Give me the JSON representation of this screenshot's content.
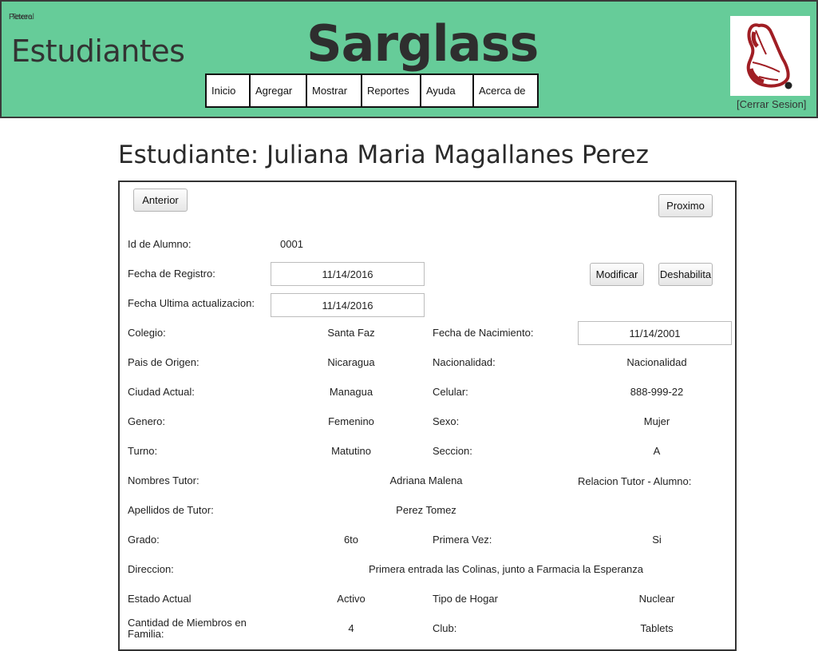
{
  "header": {
    "overlap_text_a": "Petero",
    "overlap_text_b": "Texeal",
    "app_name": "Estudiantes",
    "brand": "Sarglass",
    "logout": "[Cerrar Sesion]"
  },
  "nav": [
    "Inicio",
    "Agregar",
    "Mostrar",
    "Reportes",
    "Ayuda",
    "Acerca de"
  ],
  "page": {
    "title": "Estudiante: Juliana Maria Magallanes Perez"
  },
  "buttons": {
    "prev": "Anterior",
    "next": "Proximo",
    "edit": "Modificar",
    "disable": "Deshabilita"
  },
  "fields": {
    "id_label": "Id de Alumno:",
    "id_value": "0001",
    "registro_label": "Fecha de Registro:",
    "registro_value": "11/14/2016",
    "actualizacion_label": "Fecha Ultima actualizacion:",
    "actualizacion_value": "11/14/2016",
    "colegio_label": "Colegio:",
    "colegio_value": "Santa Faz",
    "nacimiento_label": "Fecha de Nacimiento:",
    "nacimiento_value": "11/14/2001",
    "pais_label": "Pais de Origen:",
    "pais_value": "Nicaragua",
    "nacionalidad_label": "Nacionalidad:",
    "nacionalidad_value": "Nacionalidad",
    "ciudad_label": "Ciudad Actual:",
    "ciudad_value": "Managua",
    "celular_label": "Celular:",
    "celular_value": "888-999-22",
    "genero_label": "Genero:",
    "genero_value": "Femenino",
    "sexo_label": "Sexo:",
    "sexo_value": "Mujer",
    "turno_label": "Turno:",
    "turno_value": "Matutino",
    "seccion_label": "Seccion:",
    "seccion_value": "A",
    "tutor_label": "Nombres Tutor:",
    "tutor_value": "Adriana Malena",
    "relacion_label": "Relacion Tutor - Alumno:",
    "apellidos_label": "Apellidos de Tutor:",
    "apellidos_value": "Perez Tomez",
    "grado_label": "Grado:",
    "grado_value": "6to",
    "primera_label": "Primera Vez:",
    "primera_value": "Si",
    "direccion_label": "Direccion:",
    "direccion_value": "Primera entrada las Colinas, junto a Farmacia la Esperanza",
    "estado_label": "Estado Actual",
    "estado_value": "Activo",
    "hogar_label": "Tipo de Hogar",
    "hogar_value": "Nuclear",
    "miembros_label_1": "Cantidad de Miembros en",
    "miembros_label_2": "Familia:",
    "miembros_value": "4",
    "club_label": "Club:",
    "club_value": "Tablets"
  },
  "colors": {
    "header_bg": "#66cc99",
    "logo_red": "#a01e24"
  },
  "icons": {
    "logo": "butterfly-wing-logo"
  }
}
